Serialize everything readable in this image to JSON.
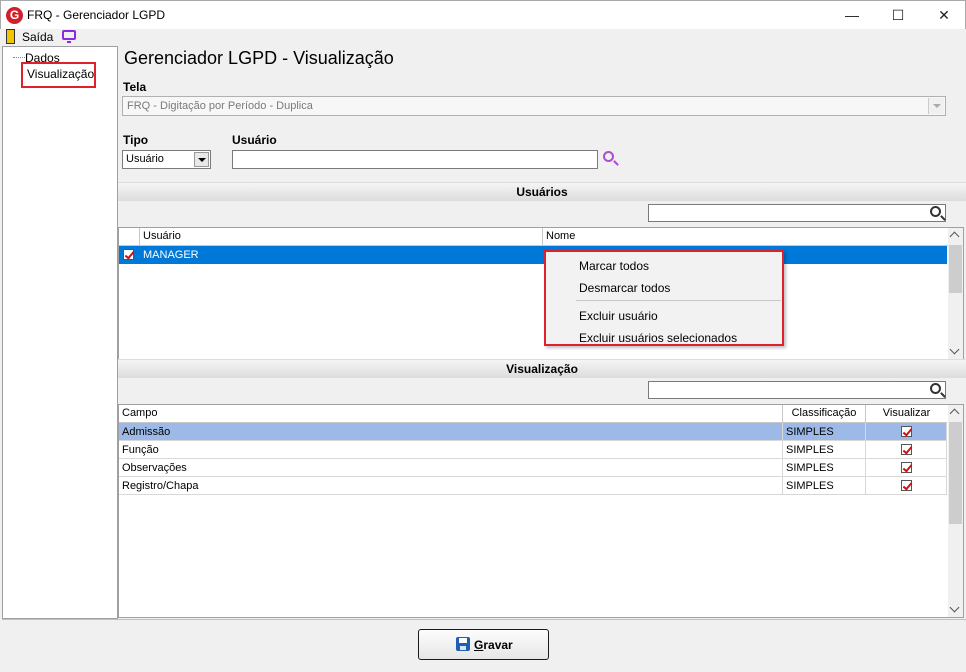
{
  "window": {
    "title": "FRQ - Gerenciador LGPD",
    "logo_letter": "G"
  },
  "menu": {
    "exit_label": "Saída"
  },
  "tree": {
    "items": [
      "Dados",
      "Visualização"
    ]
  },
  "page": {
    "title": "Gerenciador LGPD - Visualização"
  },
  "form": {
    "tela_label": "Tela",
    "tela_value": "FRQ - Digitação por Período - Duplica",
    "tipo_label": "Tipo",
    "tipo_value": "Usuário",
    "usuario_label": "Usuário",
    "usuario_value": ""
  },
  "users_section": {
    "title": "Usuários",
    "search_value": "",
    "columns": [
      "Usuário",
      "Nome"
    ],
    "rows": [
      {
        "usuario": "MANAGER",
        "nome": "",
        "checked": true,
        "selected": true
      }
    ]
  },
  "context_menu": {
    "items": [
      "Marcar todos",
      "Desmarcar todos",
      "Excluir usuário",
      "Excluir usuários selecionados"
    ]
  },
  "view_section": {
    "title": "Visualização",
    "search_value": "",
    "columns": [
      "Campo",
      "Classificação",
      "Visualizar"
    ],
    "rows": [
      {
        "campo": "Admissão",
        "classificacao": "SIMPLES",
        "visualizar": true,
        "selected": true
      },
      {
        "campo": "Função",
        "classificacao": "SIMPLES",
        "visualizar": true,
        "selected": false
      },
      {
        "campo": "Observações",
        "classificacao": "SIMPLES",
        "visualizar": true,
        "selected": false
      },
      {
        "campo": "Registro/Chapa",
        "classificacao": "SIMPLES",
        "visualizar": true,
        "selected": false
      }
    ]
  },
  "footer": {
    "save_mnemonic": "G",
    "save_rest": "ravar"
  },
  "colors": {
    "selection_blue": "#0078d7",
    "selection_light": "#9db9e8",
    "highlight_red": "#e0202a"
  }
}
